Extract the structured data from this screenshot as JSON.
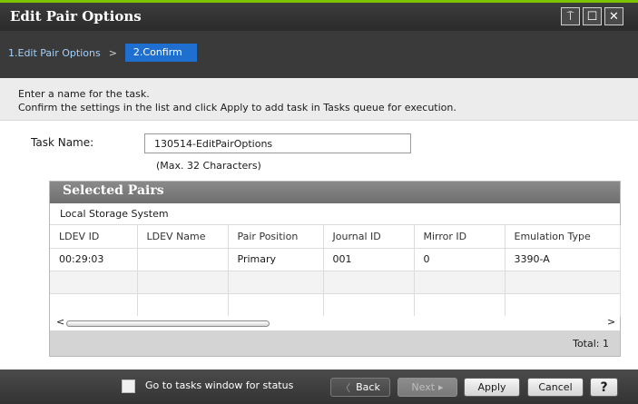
{
  "window": {
    "title": "Edit Pair Options",
    "pin_glyph": "⍑",
    "maximize_glyph": "☐",
    "close_glyph": "✕"
  },
  "breadcrumb": {
    "step1": "1.Edit Pair Options",
    "separator": ">",
    "step2": "2.Confirm"
  },
  "instructions": {
    "line1": "Enter a name for the task.",
    "line2": "Confirm the settings in the list and click Apply to add task in Tasks queue for execution."
  },
  "task": {
    "label": "Task Name:",
    "value": "130514-EditPairOptions",
    "hint": "(Max. 32 Characters)"
  },
  "pairs": {
    "title": "Selected Pairs",
    "subtitle": "Local Storage System",
    "columns": [
      "LDEV ID",
      "LDEV Name",
      "Pair Position",
      "Journal ID",
      "Mirror ID",
      "Emulation Type"
    ],
    "rows": [
      [
        "00:29:03",
        "",
        "Primary",
        "001",
        "0",
        "3390-A"
      ],
      [
        "",
        "",
        "",
        "",
        "",
        ""
      ],
      [
        "",
        "",
        "",
        "",
        "",
        ""
      ]
    ],
    "scroll_left": "<",
    "scroll_right": ">",
    "total_label": "Total:  1"
  },
  "footer": {
    "checkbox_label": "Go to tasks window for status",
    "back_label": "Back",
    "next_label": "Next",
    "apply_label": "Apply",
    "cancel_label": "Cancel",
    "help_label": "?"
  },
  "colors": {
    "accent_green": "#7dc400",
    "active_step": "#1f6fd1"
  }
}
